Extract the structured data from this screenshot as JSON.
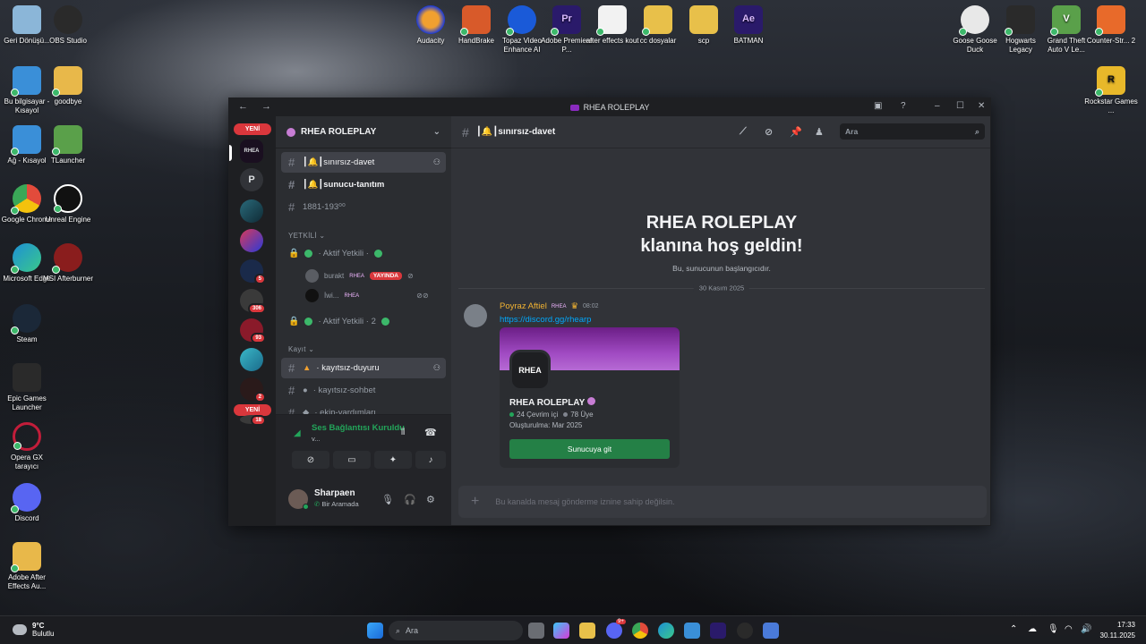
{
  "desktop": {
    "left_icons": [
      {
        "label": "Geri Dönüşü...",
        "color": "#8bb6d8"
      },
      {
        "label": "OBS Studio",
        "color": "#2a2a2a"
      },
      {
        "label": "Bu bilgisayar - Kısayol",
        "color": "#3a8fd8"
      },
      {
        "label": "goodbye",
        "color": "#e8b84a"
      },
      {
        "label": "Ağ - Kısayol",
        "color": "#3a8fd8"
      },
      {
        "label": "TLauncher",
        "color": "#5aa04a"
      },
      {
        "label": "Google Chrome",
        "color": "#e24b3b"
      },
      {
        "label": "Unreal Engine",
        "color": "#222"
      },
      {
        "label": "Microsoft Edge",
        "color": "#1d8fd6"
      },
      {
        "label": "MSI Afterburner",
        "color": "#8a1d1d"
      },
      {
        "label": "Steam",
        "color": "#1b2838"
      },
      {
        "label": "Epic Games Launcher",
        "color": "#2a2a2a"
      },
      {
        "label": "Opera GX tarayıcı",
        "color": "#c21d3a"
      },
      {
        "label": "Discord",
        "color": "#5865f2"
      },
      {
        "label": "Adobe After Effects Au...",
        "color": "#e8b84a"
      }
    ],
    "top_icons": [
      {
        "label": "Audacity",
        "color": "#f0a030"
      },
      {
        "label": "HandBrake",
        "color": "#d85a2a"
      },
      {
        "label": "Topaz Video Enhance AI",
        "color": "#1a5ad8"
      },
      {
        "label": "Adobe Premiere P...",
        "color": "#2a1a6a"
      },
      {
        "label": "after effects kout",
        "color": "#f2f2f2"
      },
      {
        "label": "cc dosyalar",
        "color": "#e8c04a"
      },
      {
        "label": "scp",
        "color": "#e8c04a"
      },
      {
        "label": "BATMAN",
        "color": "#2a1a6a"
      }
    ],
    "right_icons": [
      {
        "label": "Goose Goose Duck",
        "color": "#e8e8e8"
      },
      {
        "label": "Hogwarts Legacy",
        "color": "#2a2a2a"
      },
      {
        "label": "Grand Theft Auto V Le...",
        "color": "#5aa04a"
      },
      {
        "label": "Counter-Str... 2",
        "color": "#e86a2a"
      },
      {
        "label": "Rockstar Games ...",
        "color": "#e8b82a"
      }
    ]
  },
  "window": {
    "title": "RHEA ROLEPLAY",
    "nav": "←  →"
  },
  "guilds": {
    "new_label": "YENİ",
    "letter_server": "P",
    "badges": [
      "5",
      "306",
      "93",
      "2",
      "18"
    ],
    "rhea_label": "RHEA"
  },
  "server": {
    "name": "RHEA ROLEPLAY",
    "channels_top": [
      {
        "name": "┃🔔┃sınırsız-davet"
      },
      {
        "name": "┃🔔┃sunucu-tanıtım"
      },
      {
        "name": "1881-193⁰⁰"
      }
    ],
    "category_staff": "YETKİLİ ⌄",
    "voice_channels": [
      {
        "name": "· Aktif Yetkili ·"
      },
      {
        "name": "· Aktif Yetkili · 2"
      }
    ],
    "voice_users": [
      {
        "name": "burakt",
        "tag": "RHEA",
        "live": "YAYINDA"
      },
      {
        "name": "İwi...",
        "tag": "RHEA"
      }
    ],
    "category_kayit": "Kayıt ⌄",
    "channels_kayit": [
      {
        "name": "· kayıtsız-duyuru"
      },
      {
        "name": "· kayıtsız-sohbet"
      },
      {
        "name": "· ekip-yardımları"
      }
    ]
  },
  "voice": {
    "status": "Ses Bağlantısı Kuruldu",
    "sub": "v..."
  },
  "user": {
    "name": "Sharpaen",
    "status": "Bir Aramada"
  },
  "main": {
    "channel": "┃🔔┃sınırsız-davet",
    "search_placeholder": "Ara",
    "welcome_line1": "RHEA ROLEPLAY",
    "welcome_line2": "klanına hoş geldin!",
    "welcome_sub": "Bu, sunucunun başlangıcıdır.",
    "date_divider": "30 Kasım 2025",
    "message": {
      "author": "Poyraz Aftiel",
      "tag": "RHEA",
      "time": "08:02",
      "link": "https://discord.gg/rhearp"
    },
    "invite": {
      "icon_text": "RHEA",
      "name": "RHEA ROLEPLAY",
      "online": "24 Çevrim içi",
      "members": "78 Üye",
      "created": "Oluşturulma: Mar 2025",
      "button": "Sunucuya git"
    },
    "composer_placeholder": "Bu kanalda mesaj gönderme iznine sahip değilsin."
  },
  "taskbar": {
    "weather_temp": "9°C",
    "weather_desc": "Bulutlu",
    "search": "Ara",
    "time": "17:33",
    "date": "30.11.2025",
    "discord_badge": "9+"
  }
}
